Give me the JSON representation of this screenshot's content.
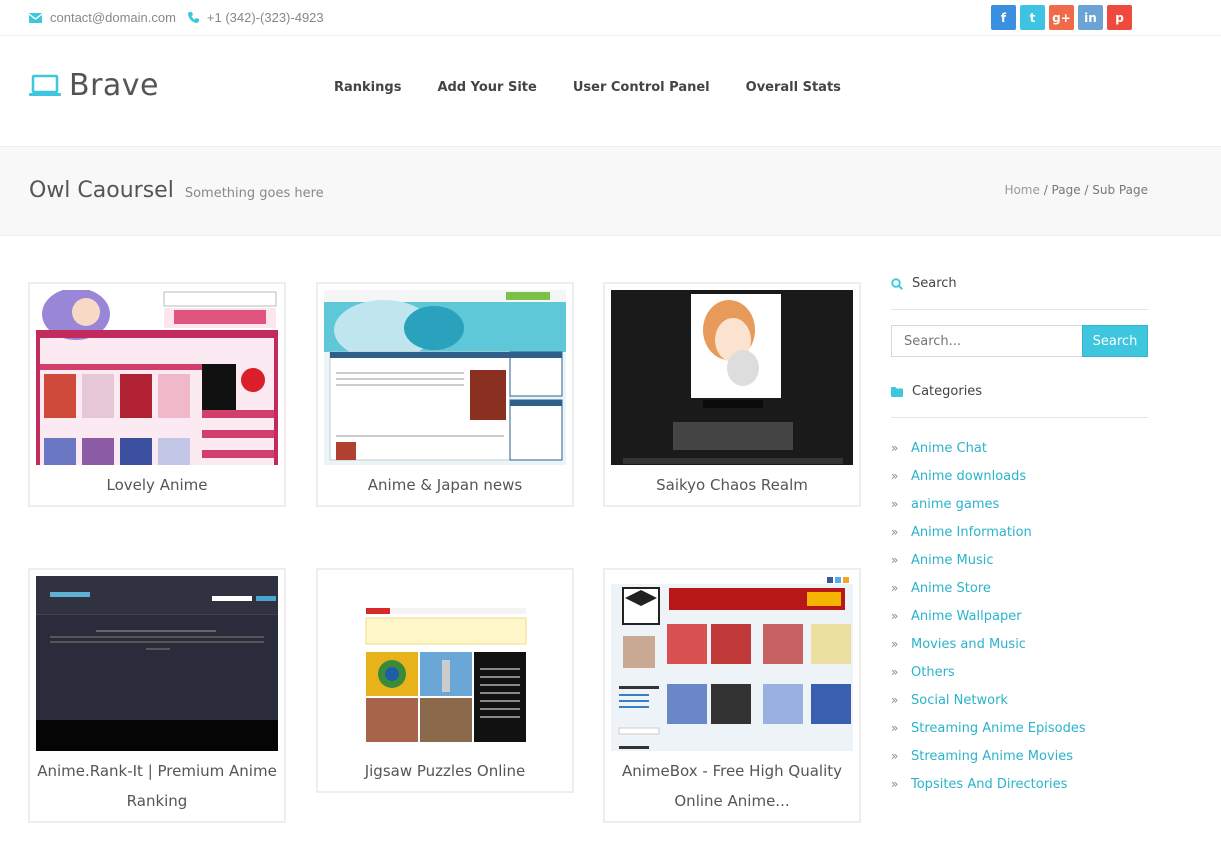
{
  "topbar": {
    "email": "contact@domain.com",
    "phone": "+1 (342)-(323)-4923",
    "social": [
      {
        "name": "facebook",
        "glyph": "f",
        "color": "#3b8fe0"
      },
      {
        "name": "twitter",
        "glyph": "t",
        "color": "#3fc3e3"
      },
      {
        "name": "google-plus",
        "glyph": "g+",
        "color": "#f06a4a"
      },
      {
        "name": "linkedin",
        "glyph": "in",
        "color": "#6aa3d4"
      },
      {
        "name": "pinterest",
        "glyph": "p",
        "color": "#ee4a3d"
      }
    ]
  },
  "header": {
    "brand": "Brave",
    "nav": [
      "Rankings",
      "Add Your Site",
      "User Control Panel",
      "Overall Stats"
    ]
  },
  "titleband": {
    "title": "Owl Caoursel",
    "subtitle": "Something goes here",
    "breadcrumb": {
      "home": "Home",
      "sep": " / ",
      "page": "Page",
      "sub": "Sub Page"
    }
  },
  "cards": [
    {
      "title_line1": "Lovely Anime",
      "title_line2": ""
    },
    {
      "title_line1": "Anime & Japan news",
      "title_line2": ""
    },
    {
      "title_line1": "Saikyo Chaos Realm",
      "title_line2": ""
    },
    {
      "title_line1": "Anime.Rank-It | Premium Anime",
      "title_line2": "Ranking"
    },
    {
      "title_line1": "Jigsaw Puzzles Online",
      "title_line2": ""
    },
    {
      "title_line1": "AnimeBox - Free High Quality",
      "title_line2": "Online Anime..."
    }
  ],
  "sidebar": {
    "search_heading": "Search",
    "search_placeholder": "Search...",
    "search_button": "Search",
    "categories_heading": "Categories",
    "categories": [
      "Anime Chat",
      "Anime downloads",
      "anime games",
      "Anime Information",
      "Anime Music",
      "Anime Store",
      "Anime Wallpaper",
      "Movies and Music",
      "Others",
      "Social Network",
      "Streaming Anime Episodes",
      "Streaming Anime Movies",
      "Topsites And Directories"
    ]
  },
  "accent_color": "#3ec6df"
}
